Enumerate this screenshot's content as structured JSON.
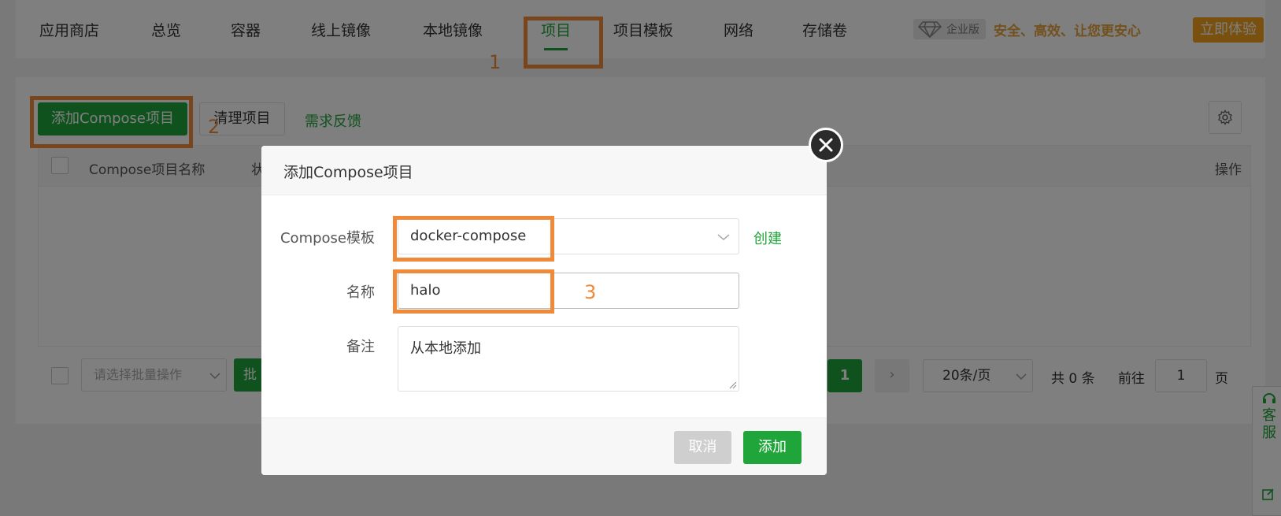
{
  "nav": {
    "items": [
      {
        "label": "应用商店"
      },
      {
        "label": "总览"
      },
      {
        "label": "容器"
      },
      {
        "label": "线上镜像"
      },
      {
        "label": "本地镜像"
      },
      {
        "label": "项目"
      },
      {
        "label": "项目模板"
      },
      {
        "label": "网络"
      },
      {
        "label": "存储卷"
      }
    ],
    "active_index": 5
  },
  "enterprise": {
    "badge": "企业版",
    "slogan": "安全、高效、让您更安心",
    "try_button": "立即体验"
  },
  "toolbar": {
    "add_compose": "添加Compose项目",
    "clean": "清理项目",
    "feedback": "需求反馈"
  },
  "table": {
    "columns": [
      "Compose项目名称",
      "状",
      "操作"
    ]
  },
  "pagination": {
    "batch_placeholder": "请选择批量操作",
    "batch_button": "批",
    "current_page": "1",
    "next": "›",
    "page_size": "20条/页",
    "total": "共 0 条",
    "goto_label": "前往",
    "goto_value": "1",
    "page_suffix": "页"
  },
  "service_panel": {
    "label": "客服"
  },
  "dialog": {
    "title": "添加Compose项目",
    "template_label": "Compose模板",
    "template_value": "docker-compose",
    "create_link": "创建",
    "name_label": "名称",
    "name_value": "halo",
    "remark_label": "备注",
    "remark_value": "从本地添加",
    "cancel": "取消",
    "add": "添加"
  },
  "annotations": [
    "1",
    "2",
    "3"
  ],
  "colors": {
    "accent": "#20a53a",
    "annotation": "#f08a3b",
    "enterprise": "#f2a11a"
  }
}
